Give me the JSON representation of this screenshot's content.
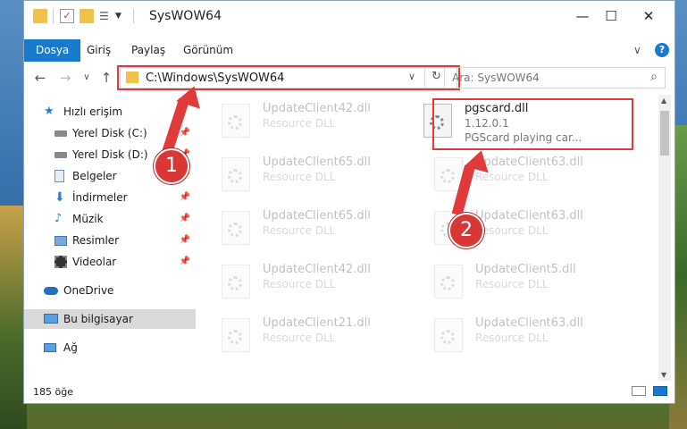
{
  "window": {
    "title": "SysWOW64",
    "minimize": "—",
    "maximize": "☐",
    "close": "✕"
  },
  "ribbon": {
    "tabs": [
      "Dosya",
      "Giriş",
      "Paylaş",
      "Görünüm"
    ],
    "expand": "∨",
    "help": "?"
  },
  "nav": {
    "back": "←",
    "forward": "→",
    "recent": "∨",
    "up": "↑"
  },
  "address": {
    "path": "C:\\Windows\\SysWOW64",
    "dropdown": "∨",
    "refresh": "↻"
  },
  "search": {
    "placeholder": "Ara: SysWOW64",
    "icon": "⌕"
  },
  "sidebar": {
    "items": [
      {
        "label": "Hızlı erişim",
        "icon": "star-icon"
      },
      {
        "label": "Yerel Disk (C:)",
        "icon": "drive-icon",
        "pinned": true
      },
      {
        "label": "Yerel Disk (D:)",
        "icon": "drive-icon",
        "pinned": true
      },
      {
        "label": "Belgeler",
        "icon": "documents-icon",
        "pinned": true
      },
      {
        "label": "İndirmeler",
        "icon": "download-icon",
        "pinned": true
      },
      {
        "label": "Müzik",
        "icon": "music-icon",
        "pinned": true
      },
      {
        "label": "Resimler",
        "icon": "pictures-icon",
        "pinned": true
      },
      {
        "label": "Videolar",
        "icon": "videos-icon",
        "pinned": true
      },
      {
        "label": "OneDrive",
        "icon": "cloud-icon"
      },
      {
        "label": "Bu bilgisayar",
        "icon": "computer-icon",
        "selected": true
      },
      {
        "label": "Ağ",
        "icon": "network-icon"
      }
    ],
    "pin_glyph": "📌"
  },
  "files": [
    {
      "name": "UpdateClient42.dll",
      "type": "Resource DLL"
    },
    {
      "name": "pgscard.dll",
      "version": "1.12.0.1",
      "description": "PGScard playing car..."
    },
    {
      "name": "UpdateClient65.dll",
      "type": "Resource DLL"
    },
    {
      "name": "UpdateClient63.dll",
      "type": "Resource DLL"
    },
    {
      "name": "UpdateClient65.dll",
      "type": "Resource DLL"
    },
    {
      "name": "UpdateClient63.dll",
      "type": "Resource DLL"
    },
    {
      "name": "UpdateClient42.dll",
      "type": "Resource DLL"
    },
    {
      "name": "UpdateClient5.dll",
      "type": "Resource DLL"
    },
    {
      "name": "UpdateClient21.dll",
      "type": "Resource DLL"
    },
    {
      "name": "UpdateClient63.dll",
      "type": "Resource DLL"
    }
  ],
  "annotations": {
    "step1": "1",
    "step2": "2"
  },
  "status": {
    "count": "185 öğe"
  },
  "colors": {
    "accent": "#1979ca",
    "highlight": "#e03a3a"
  }
}
